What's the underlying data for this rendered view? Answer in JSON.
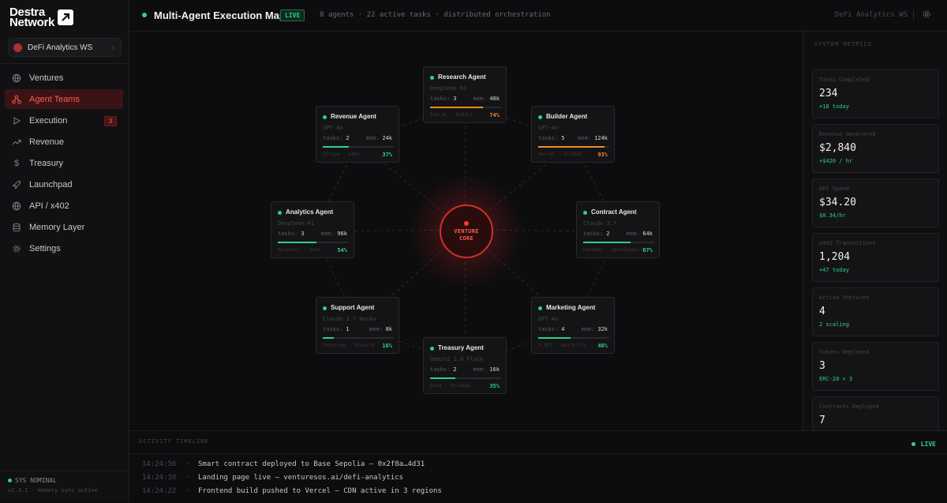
{
  "brand": {
    "line1": "Destra",
    "line2": "Network"
  },
  "workspace": {
    "name": "DeFi Analytics WS"
  },
  "nav": [
    {
      "label": "Ventures",
      "icon": "globe-icon"
    },
    {
      "label": "Agent Teams",
      "icon": "network-icon",
      "active": true
    },
    {
      "label": "Execution",
      "icon": "play-icon",
      "badge": "3"
    },
    {
      "label": "Revenue",
      "icon": "trending-up-icon"
    },
    {
      "label": "Treasury",
      "icon": "dollar-icon"
    },
    {
      "label": "Launchpad",
      "icon": "rocket-icon"
    },
    {
      "label": "API / x402",
      "icon": "globe-icon"
    },
    {
      "label": "Memory Layer",
      "icon": "database-icon"
    },
    {
      "label": "Settings",
      "icon": "gear-icon"
    }
  ],
  "system": {
    "status": "SYS NOMINAL",
    "sub": "v2.4.1 · memory sync active"
  },
  "header": {
    "title": "Multi-Agent Execution Map",
    "live": "LIVE",
    "meta": "8 agents · 22 active tasks · distributed orchestration",
    "workspace": "DeFi Analytics WS"
  },
  "core": {
    "line1": "VENTURE",
    "line2": "CORE"
  },
  "agents": [
    {
      "name": "Research Agent",
      "model": "DeepSeek-R1",
      "tasks_label": "tasks:",
      "tasks": "3",
      "mem_label": "mem:",
      "mem": "48k",
      "tags": "Exa.ai · Reddit",
      "progress": 74,
      "color": "#f08a24"
    },
    {
      "name": "Revenue Agent",
      "model": "GPT-4o",
      "tasks_label": "tasks:",
      "tasks": "2",
      "mem_label": "mem:",
      "mem": "24k",
      "tags": "Stripe · x402",
      "progress": 37,
      "color": "#2fd08a"
    },
    {
      "name": "Builder Agent",
      "model": "GPT-4o",
      "tasks_label": "tasks:",
      "tasks": "5",
      "mem_label": "mem:",
      "mem": "124k",
      "tags": "Vercel · GitHub",
      "progress": 93,
      "color": "#f08a24"
    },
    {
      "name": "Analytics Agent",
      "model": "DeepSeek-R1",
      "tasks_label": "tasks:",
      "tasks": "3",
      "mem_label": "mem:",
      "mem": "96k",
      "tags": "Mixpanel · Dune",
      "progress": 54,
      "color": "#2fd08a"
    },
    {
      "name": "Contract Agent",
      "model": "Claude 3.7",
      "tasks_label": "tasks:",
      "tasks": "2",
      "mem_label": "mem:",
      "mem": "64k",
      "tags": "Hardhat · OpenZeppelin",
      "progress": 67,
      "color": "#2fd08a"
    },
    {
      "name": "Support Agent",
      "model": "Claude 3.7 Haiku",
      "tasks_label": "tasks:",
      "tasks": "1",
      "mem_label": "mem:",
      "mem": "8k",
      "tags": "Intercom · Discord",
      "progress": 16,
      "color": "#2fd08a"
    },
    {
      "name": "Marketing Agent",
      "model": "GPT-4o",
      "tasks_label": "tasks:",
      "tasks": "4",
      "mem_label": "mem:",
      "mem": "32k",
      "tags": "X API · Analytics",
      "progress": 46,
      "color": "#2fd08a"
    },
    {
      "name": "Treasury Agent",
      "model": "Gemini 2.0 Flash",
      "tasks_label": "tasks:",
      "tasks": "2",
      "mem_label": "mem:",
      "mem": "16k",
      "tags": "Base · Uniswap",
      "progress": 35,
      "color": "#2fd08a"
    }
  ],
  "metrics": {
    "title": "SYSTEM METRICS",
    "cards": [
      {
        "label": "Tasks Completed",
        "value": "234",
        "delta": "+18 today"
      },
      {
        "label": "Revenue Generated",
        "value": "$2,840",
        "delta": "+$420 / hr"
      },
      {
        "label": "API Spend",
        "value": "$34.20",
        "delta": "$0.34/hr"
      },
      {
        "label": "x402 Transactions",
        "value": "1,204",
        "delta": "+47 today"
      },
      {
        "label": "Active Ventures",
        "value": "4",
        "delta": "2 scaling"
      },
      {
        "label": "Tokens Deployed",
        "value": "3",
        "delta": "ERC-20 × 3"
      },
      {
        "label": "Contracts Deployed",
        "value": "7",
        "delta": ""
      }
    ]
  },
  "activity": {
    "title": "ACTIVITY TIMELINE",
    "live": "LIVE",
    "rows": [
      {
        "time": "14:24:56",
        "msg": "Smart contract deployed to Base Sepolia — 0x2f8a…4d31"
      },
      {
        "time": "14:24:38",
        "msg": "Landing page live — venturesos.ai/defi-analytics"
      },
      {
        "time": "14:24:22",
        "msg": "Frontend build pushed to Vercel — CDN active in 3 regions"
      }
    ]
  }
}
